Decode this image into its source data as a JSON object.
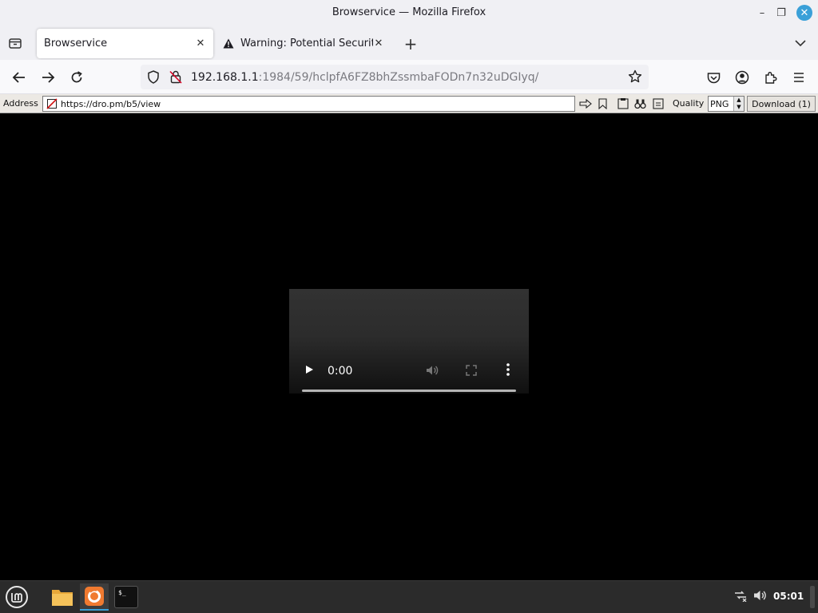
{
  "window": {
    "title": "Browservice — Mozilla Firefox",
    "minimize_icon": "minimize-icon",
    "maximize_icon": "restore-icon",
    "close_icon": "close-icon",
    "minimize_glyph": "–",
    "maximize_glyph": "❐",
    "close_glyph": "✕",
    "accent_color": "#3aa0d8"
  },
  "tabs": [
    {
      "label": "Browservice",
      "active": true,
      "close_glyph": "✕"
    },
    {
      "label": "Warning: Potential Security",
      "active": false,
      "icon": "warning-icon",
      "close_glyph": "✕"
    }
  ],
  "new_tab_glyph": "+",
  "navbar": {
    "url_host": "192.168.1.1",
    "url_rest": ":1984/59/hclpfA6FZ8bhZssmbaFODn7n32uDGIyq/",
    "icons": [
      "back-arrow-icon",
      "forward-arrow-icon",
      "reload-icon",
      "shield-icon",
      "insecure-lock-icon",
      "bookmark-star-icon",
      "pocket-icon",
      "account-icon",
      "extensions-icon",
      "menu-icon"
    ]
  },
  "appbar": {
    "address_label": "Address",
    "address_value": "https://dro.pm/b5/view",
    "quality_label": "Quality",
    "quality_value": "PNG",
    "download_label": "Download (1)"
  },
  "video": {
    "time": "0:00",
    "progress": 0.0
  },
  "taskbar": {
    "clock": "05:01",
    "items": [
      "mint-menu-icon",
      "folder-icon",
      "firefox-icon",
      "terminal-icon"
    ],
    "tray": [
      "network-disconnected-icon",
      "volume-icon"
    ],
    "terminal_glyph": "$_"
  }
}
